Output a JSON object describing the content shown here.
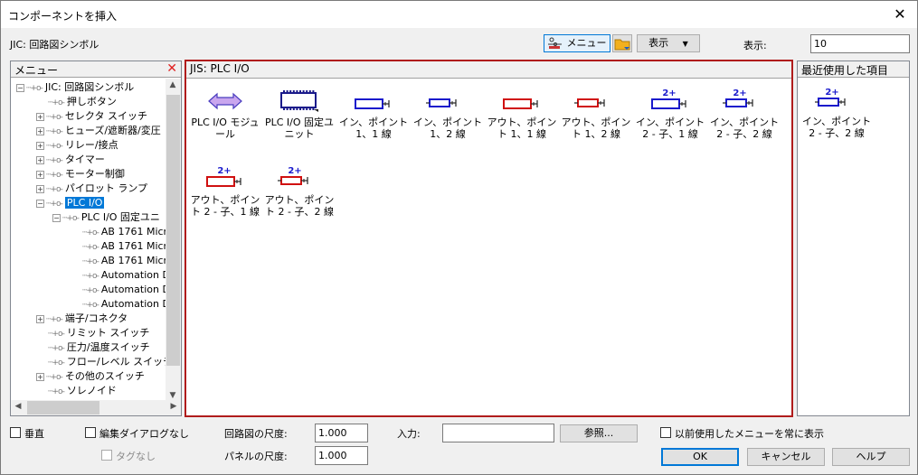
{
  "window": {
    "title": "コンポーネントを挿入",
    "close_glyph": "✕"
  },
  "toolbar": {
    "library_label": "JIC: 回路図シンボル",
    "menu_button": "メニュー",
    "view_button": "表示",
    "view_label": "表示:",
    "view_value": "10"
  },
  "left_pane": {
    "header": "メニュー",
    "close_glyph": "✕",
    "items": [
      {
        "label": "JIC: 回路図シンボル",
        "expander": "−",
        "root": true
      },
      {
        "label": "押しボタン",
        "expander": ""
      },
      {
        "label": "セレクタ スイッチ",
        "expander": "+"
      },
      {
        "label": "ヒューズ/遮断器/変圧",
        "expander": "+"
      },
      {
        "label": "リレー/接点",
        "expander": "+"
      },
      {
        "label": "タイマー",
        "expander": "+"
      },
      {
        "label": "モーター制御",
        "expander": "+"
      },
      {
        "label": "パイロット ランプ",
        "expander": "+"
      },
      {
        "label": "PLC I/O",
        "expander": "−",
        "selected": true
      },
      {
        "label": "PLC I/O 固定ユニ",
        "expander": "−",
        "level": 2
      },
      {
        "label": "AB 1761 Micr",
        "expander": "",
        "level": 3
      },
      {
        "label": "AB 1761 Micr",
        "expander": "",
        "level": 3
      },
      {
        "label": "AB 1761 Micr",
        "expander": "",
        "level": 3
      },
      {
        "label": "Automation D",
        "expander": "",
        "level": 3
      },
      {
        "label": "Automation D",
        "expander": "",
        "level": 3
      },
      {
        "label": "Automation D",
        "expander": "",
        "level": 3
      },
      {
        "label": "端子/コネクタ",
        "expander": "+"
      },
      {
        "label": "リミット スイッチ",
        "expander": ""
      },
      {
        "label": "圧力/温度スイッチ",
        "expander": ""
      },
      {
        "label": "フロー/レベル スイッチ",
        "expander": ""
      },
      {
        "label": "その他のスイッチ",
        "expander": "+"
      },
      {
        "label": "ソレノイド",
        "expander": ""
      }
    ]
  },
  "center_pane": {
    "header": "JIS: PLC I/O",
    "tiles": [
      {
        "label": "PLC I/O モジュール",
        "icon": "double-arrow-icon"
      },
      {
        "label": "PLC I/O 固定ユニット",
        "icon": "fixed-unit-icon"
      },
      {
        "label": "イン、ポイント 1、1 線",
        "icon": "input-1pt-1wire-icon"
      },
      {
        "label": "イン、ポイント 1、2 線",
        "icon": "input-1pt-2wire-icon"
      },
      {
        "label": "アウト、ポイント 1、1 線",
        "icon": "output-1pt-1wire-icon"
      },
      {
        "label": "アウト、ポイント 1、2 線",
        "icon": "output-1pt-2wire-icon"
      },
      {
        "label": "イン、ポイント 2 - 子、1 線",
        "icon": "input-2pt-1wire-icon"
      },
      {
        "label": "イン、ポイント 2 - 子、2 線",
        "icon": "input-2pt-2wire-icon"
      },
      {
        "label": "アウト、ポイント 2 - 子、1 線",
        "icon": "output-2pt-1wire-icon"
      },
      {
        "label": "アウト、ポイント 2 - 子、2 線",
        "icon": "output-2pt-2wire-icon"
      }
    ],
    "badge_2plus": "2+"
  },
  "right_pane": {
    "header": "最近使用した項目",
    "tiles": [
      {
        "label": "イン、ポイント 2 - 子、2 線",
        "icon": "input-2pt-2wire-icon"
      }
    ]
  },
  "footer": {
    "vertical": "垂直",
    "no_edit_dialog": "編集ダイアログなし",
    "no_tag": "タグなし",
    "schematic_scale_label": "回路図の尺度:",
    "schematic_scale_value": "1.000",
    "panel_scale_label": "パネルの尺度:",
    "panel_scale_value": "1.000",
    "input_label": "入力:",
    "input_value": "",
    "browse_button": "参照...",
    "always_show_recent": "以前使用したメニューを常に表示",
    "ok": "OK",
    "cancel": "キャンセル",
    "help": "ヘルプ"
  },
  "colors": {
    "accent": "#0078d7",
    "frame_red": "#b01c1c",
    "blue_symbol": "#1a1acc",
    "red_symbol": "#d01010"
  }
}
